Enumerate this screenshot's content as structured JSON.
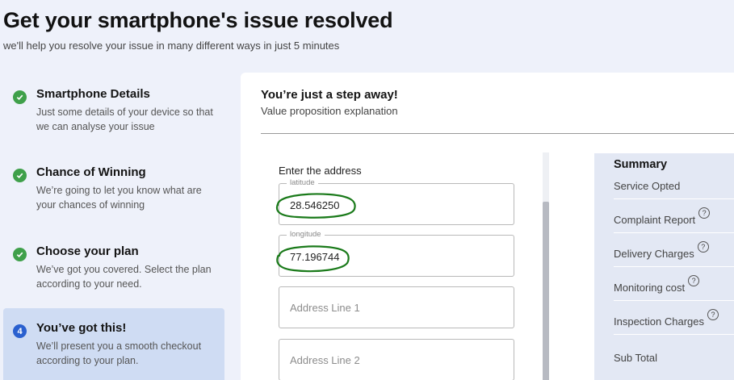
{
  "header": {
    "title": "Get your smartphone's issue resolved",
    "subtitle": "we'll help you resolve your issue in many different ways in just 5 minutes"
  },
  "steps": [
    {
      "status": "done",
      "title": "Smartphone Details",
      "description": "Just some details of your device so that we can analyse your issue"
    },
    {
      "status": "done",
      "title": "Chance of Winning",
      "description": "We’re going to let you know what are your chances of winning"
    },
    {
      "status": "done",
      "title": "Choose your plan",
      "description": "We’ve got you covered. Select the plan according to your need."
    },
    {
      "status": "current",
      "number": "4",
      "title": "You’ve got this!",
      "description": "We’ll present you a smooth checkout according to your plan."
    }
  ],
  "card": {
    "title": "You’re just a step away!",
    "subtitle": "Value proposition explanation"
  },
  "form": {
    "label": "Enter the address",
    "latitude": {
      "legend": "latitude",
      "value": "28.546250"
    },
    "longitude": {
      "legend": "longitude",
      "value": "77.196744"
    },
    "address1": {
      "placeholder": "Address Line 1"
    },
    "address2": {
      "placeholder": "Address Line 2"
    }
  },
  "summary": {
    "title": "Summary",
    "rows": [
      {
        "label": "Service Opted",
        "help": false
      },
      {
        "label": "Complaint Report",
        "help": true
      },
      {
        "label": "Delivery Charges",
        "help": true
      },
      {
        "label": "Monitoring cost",
        "help": true
      },
      {
        "label": "Inspection Charges",
        "help": true
      },
      {
        "label": "Sub Total",
        "help": false
      }
    ],
    "help_glyph": "?"
  },
  "colors": {
    "background": "#eef1fa",
    "done": "#3fa04a",
    "current": "#2a60cf",
    "active_step_bg": "#cfdcf3",
    "annotation": "#1a7a1a"
  }
}
